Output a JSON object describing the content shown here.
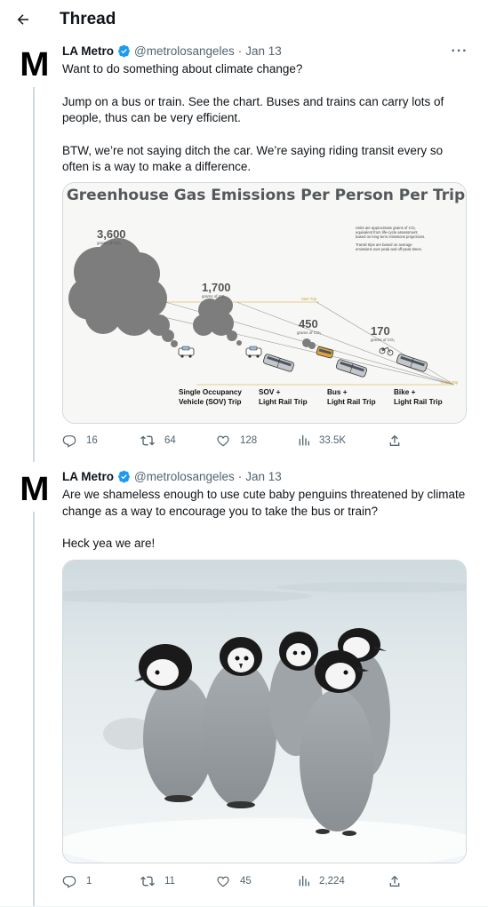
{
  "header": {
    "title": "Thread"
  },
  "tweets": [
    {
      "author": {
        "name": "LA Metro",
        "handle": "@metrolosangeles",
        "avatar_letter": "M"
      },
      "date": "Jan 13",
      "paragraphs": [
        "Want to do something about climate change?",
        "Jump on a bus or train. See the chart. Buses and trains can carry lots of people, thus can be very efficient.",
        "BTW, we’re not saying ditch the car. We’re saying riding transit every so often is a way to make a difference."
      ],
      "stats": {
        "replies": "16",
        "retweets": "64",
        "likes": "128",
        "views": "33.5K"
      }
    },
    {
      "author": {
        "name": "LA Metro",
        "handle": "@metrolosangeles",
        "avatar_letter": "M"
      },
      "date": "Jan 13",
      "paragraphs": [
        "Are we shameless enough to use cute baby penguins threatened by climate change as a way to encourage you to take the bus or train?",
        "Heck yea we are!"
      ],
      "stats": {
        "replies": "1",
        "retweets": "11",
        "likes": "45",
        "views": "2,224"
      }
    }
  ],
  "infographic": {
    "title": "Greenhouse Gas Emissions Per Person Per Trip",
    "note_1": "Units are approximate grams of CO₂ equivalent from life-cycle assessment based on long-term emissions projections.",
    "note_2": "Transit trips are based on average emissions over peak and off-peak times.",
    "unit": "grams of CO₂",
    "start_label": "Start Trip",
    "finish_label": "Finish Trip",
    "modes": [
      {
        "value": "3,600",
        "label_1": "Single Occupancy",
        "label_2": "Vehicle (SOV) Trip"
      },
      {
        "value": "1,700",
        "label_1": "SOV +",
        "label_2": "Light Rail Trip"
      },
      {
        "value": "450",
        "label_1": "Bus +",
        "label_2": "Light Rail Trip"
      },
      {
        "value": "170",
        "label_1": "Bike +",
        "label_2": "Light Rail Trip"
      }
    ]
  },
  "colors": {
    "text": "#0f1419",
    "secondary": "#536471",
    "verified": "#1d9bf0",
    "border": "#cfd9de",
    "smoke": "#7d7d7d"
  },
  "icons": [
    "back-arrow-icon",
    "verified-badge-icon",
    "more-icon",
    "reply-icon",
    "retweet-icon",
    "like-icon",
    "views-icon",
    "share-icon"
  ]
}
